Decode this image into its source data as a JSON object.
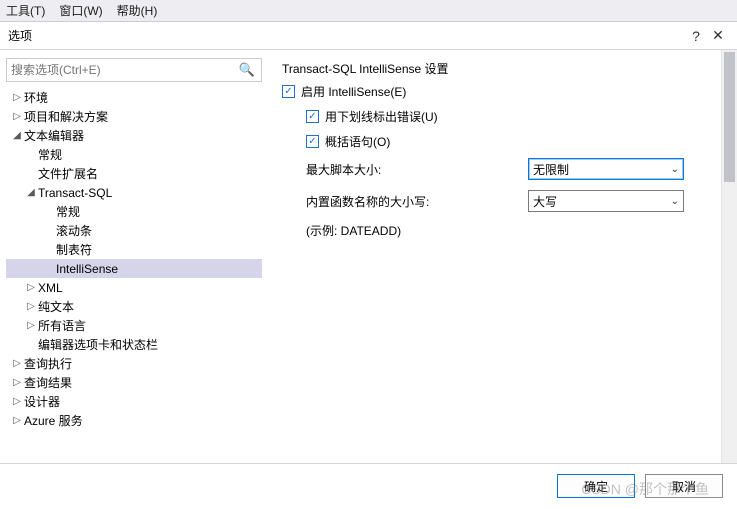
{
  "menubar": {
    "tools": "工具(T)",
    "window": "窗口(W)",
    "help": "帮助(H)"
  },
  "dialog": {
    "title": "选项",
    "help_icon": "?",
    "close_icon": "✕"
  },
  "search": {
    "placeholder": "搜索选项(Ctrl+E)"
  },
  "tree": {
    "env": "环境",
    "proj": "项目和解决方案",
    "text_editor": "文本编辑器",
    "general": "常规",
    "file_ext": "文件扩展名",
    "tsql": "Transact-SQL",
    "tsql_general": "常规",
    "tsql_scroll": "滚动条",
    "tsql_tabs": "制表符",
    "tsql_intellisense": "IntelliSense",
    "xml": "XML",
    "plain": "纯文本",
    "all_lang": "所有语言",
    "editor_tabs": "编辑器选项卡和状态栏",
    "query_exec": "查询执行",
    "query_res": "查询结果",
    "designer": "设计器",
    "azure": "Azure 服务"
  },
  "panel": {
    "group_title": "Transact-SQL IntelliSense 设置",
    "enable": "启用 IntelliSense(E)",
    "underline_errors": "用下划线标出错误(U)",
    "outline": "概括语句(O)",
    "max_script": "最大脚本大小:",
    "max_script_value": "无限制",
    "func_case": "内置函数名称的大小写:",
    "func_case_value": "大写",
    "example": "(示例: DATEADD)"
  },
  "buttons": {
    "ok": "确定",
    "cancel": "取消"
  },
  "watermark": "CSDN @那个那个鱼"
}
